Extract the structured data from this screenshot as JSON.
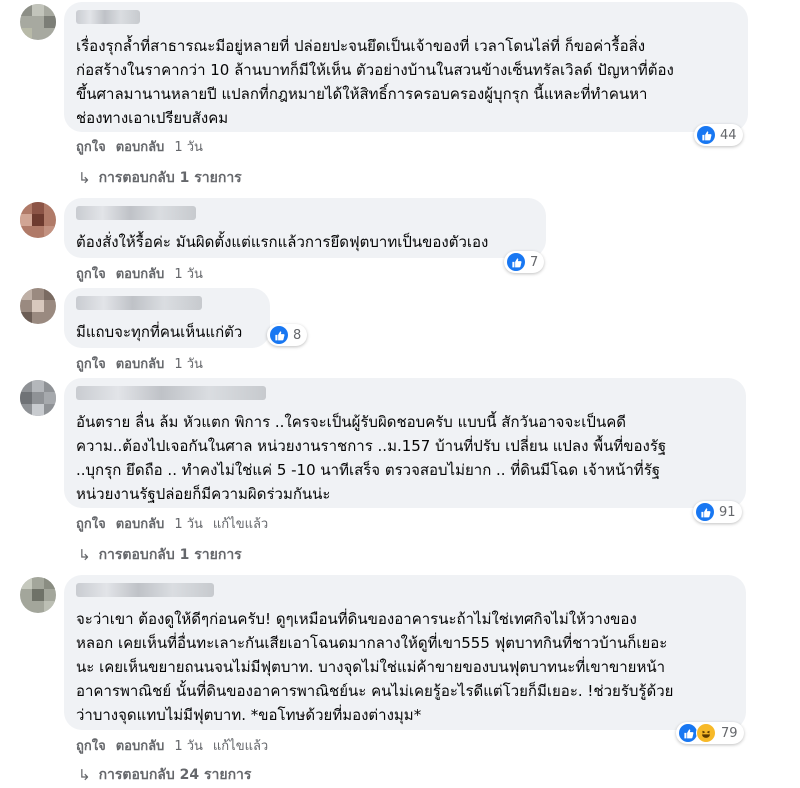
{
  "colors": {
    "like": "#1877f2",
    "haha": "#f7b928",
    "bubble": "#f0f2f5",
    "meta": "#65676b"
  },
  "comments": [
    {
      "text": "เรื่องรุกล้ำที่สาธารณะมีอยู่หลายที่ ปล่อยปะจนยึดเป็นเจ้าของที่ เวลาโดนไล่ที่ ก็ขอค่ารื้อสิ่ง\nก่อสร้างในราคากว่า 10 ล้านบาทก็มีให้เห็น ตัวอย่างบ้านในสวนข้างเซ็นทรัลเวิลด์ ปัญหาที่ต้อง\nขึ้นศาลมานานหลายปี แปลกที่กฎหมายได้ให้สิทธิ์การครอบครองผู้บุกรุก นี้แหละที่ทำคนหา\nช่องทางเอาเปรียบสังคม",
      "reactions": "44",
      "like": "ถูกใจ",
      "reply": "ตอบกลับ",
      "time": "1 วัน",
      "edited": "",
      "replies": "การตอบกลับ 1 รายการ"
    },
    {
      "text": "ต้องสั่งให้รื้อค่ะ มันผิดตั้งแต่แรกแล้วการยึดฟุตบาทเป็นของตัวเอง",
      "reactions": "7",
      "like": "ถูกใจ",
      "reply": "ตอบกลับ",
      "time": "1 วัน"
    },
    {
      "text": "มีแถบจะทุกที่คนเห็นแก่ตัว",
      "reactions": "8",
      "like": "ถูกใจ",
      "reply": "ตอบกลับ",
      "time": "1 วัน"
    },
    {
      "text": "อันตราย ลื่น ล้ม หัวแตก พิการ ..ใครจะเป็นผู้รับผิดชอบครับ แบบนี้ สักวันอาจจะเป็นคดี\nความ..ต้องไปเจอกันในศาล หน่วยงานราชการ ..ม.157 บ้านที่ปรับ เปลี่ยน แปลง พื้นที่ของรัฐ\n..บุกรุก ยึดถือ .. ทำคงไม่ใช่แค่ 5 -10 นาทีเสร็จ ตรวจสอบไม่ยาก .. ที่ดินมีโฉด เจ้าหน้าที่รัฐ\nหน่วยงานรัฐปล่อยก็มีความผิดร่วมกันน่ะ",
      "reactions": "91",
      "like": "ถูกใจ",
      "reply": "ตอบกลับ",
      "time": "1 วัน",
      "edited": "แก้ไขแล้ว",
      "replies": "การตอบกลับ 1 รายการ"
    },
    {
      "text": "จะว่าเขา ต้องดูให้ดีๆก่อนครับ! ดูๆเหมือนที่ดินของอาคารนะถ้าไม่ใช่เทศกิจไม่ให้วางของ\nหลอก เคยเห็นที่อื่นทะเลาะกันเสียเอาโฉนดมากลางให้ดูที่เขา555 ฟุตบาทกินที่ชาวบ้านก็เยอะ\nนะ เคยเห็นขยายถนนจนไม่มีฟุตบาท. บางจุดไม่ใช่แม่ค้าขายของบนฟุตบาทนะที่เขาขายหน้า\nอาคารพาณิชย์ นั้นที่ดินของอาคารพาณิชย์นะ คนไม่เคยรู้อะไรดีแต่โวยก็มีเยอะ. !ช่วยรับรู้ด้วย\nว่าบางจุดแทบไม่มีฟุตบาท. *ขอโทษด้วยที่มองต่างมุม*",
      "reactions": "79",
      "like": "ถูกใจ",
      "reply": "ตอบกลับ",
      "time": "1 วัน",
      "edited": "แก้ไขแล้ว",
      "replies": "การตอบกลับ 24 รายการ"
    }
  ]
}
